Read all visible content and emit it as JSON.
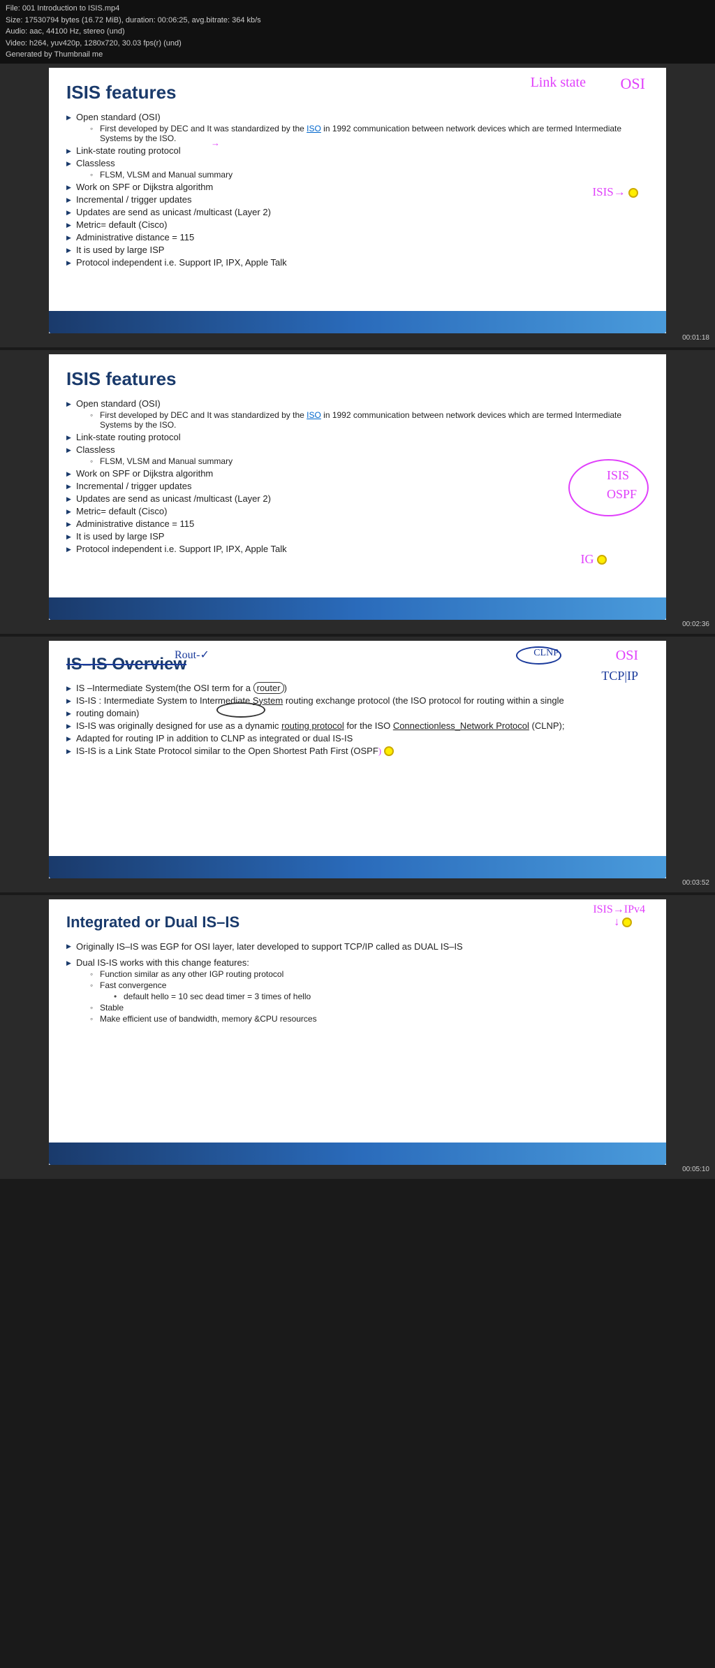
{
  "videoInfo": {
    "filename": "File: 001 Introduction to ISIS.mp4",
    "size": "Size: 17530794 bytes (16.72 MiB), duration: 00:06:25, avg.bitrate: 364 kb/s",
    "audio": "Audio: aac, 44100 Hz, stereo (und)",
    "video": "Video: h264, yuv420p, 1280x720, 30.03 fps(r) (und)",
    "generated": "Generated by Thumbnail me"
  },
  "slides": [
    {
      "id": "slide1",
      "title": "ISIS features",
      "timestamp": "00:01:18",
      "annotations": {
        "ann1": "Link state",
        "ann2": "OSI",
        "ann3": "ISIS→"
      },
      "items": [
        {
          "text": "Open standard (OSI)",
          "sub": [
            "First developed by DEC and It was standardized by the ISO in 1992 communication between network devices which are termed Intermediate Systems by the ISO."
          ]
        },
        {
          "text": "Link-state routing protocol"
        },
        {
          "text": "Classless",
          "sub": [
            "FLSM, VLSM and Manual summary"
          ]
        },
        {
          "text": "Work on SPF or Dijkstra algorithm"
        },
        {
          "text": "Incremental / trigger updates"
        },
        {
          "text": "Updates are send as unicast  /multicast (Layer 2)"
        },
        {
          "text": "Metric= default (Cisco)"
        },
        {
          "text": "Administrative distance  = 115"
        },
        {
          "text": "It is used by large ISP"
        },
        {
          "text": "Protocol independent i.e. Support IP, IPX, Apple Talk"
        }
      ]
    },
    {
      "id": "slide2",
      "title": "ISIS features",
      "timestamp": "00:02:36",
      "annotations": {
        "circle_text1": "ISIS",
        "circle_text2": "OSPF",
        "ann_ig": "IG"
      },
      "items": [
        {
          "text": "Open standard (OSI)",
          "sub": [
            "First developed by DEC and It was standardized by the ISO in 1992 communication between network devices which are termed Intermediate Systems by the ISO."
          ]
        },
        {
          "text": "Link-state routing protocol"
        },
        {
          "text": "Classless",
          "sub": [
            "FLSM, VLSM and Manual summary"
          ]
        },
        {
          "text": "Work on SPF or Dijkstra algorithm"
        },
        {
          "text": "Incremental / trigger updates"
        },
        {
          "text": "Updates are send as unicast  /multicast (Layer 2)"
        },
        {
          "text": "Metric= default (Cisco)"
        },
        {
          "text": "Administrative distance  = 115"
        },
        {
          "text": "It is used by large ISP"
        },
        {
          "text": "Protocol independent i.e. Support IP, IPX, Apple Talk"
        }
      ]
    },
    {
      "id": "slide3",
      "title": "IS–IS Overview",
      "timestamp": "00:03:52",
      "annotations": {
        "ann_rout": "Rout-✓",
        "ann_osi": "OSI",
        "ann_tcp": "TCP|IP",
        "ann_clnp": "CLNP"
      },
      "items": [
        {
          "text": "IS –Intermediate System(the OSI term for a router)"
        },
        {
          "text": "IS-IS : Intermediate System  to Intermediate System routing exchange protocol (the ISO protocol for routing within a single"
        },
        {
          "text": "routing domain)"
        },
        {
          "text": "IS-IS was originally designed for use as a dynamic routing protocol for the ISO Connectionless_Network Protocol (CLNP);"
        },
        {
          "text": "Adapted for routing IP in addition to CLNP  as integrated or dual IS-IS"
        },
        {
          "text": "IS-IS is a Link State Protocol similar to the Open Shortest Path First (OSPF)"
        }
      ]
    },
    {
      "id": "slide4",
      "title": "Integrated or Dual IS–IS",
      "timestamp": "00:05:10",
      "annotations": {
        "ann1": "ISIS→IPv4"
      },
      "items": [
        {
          "text": "Originally IS–IS was EGP for OSI layer, later developed  to support TCP/IP called as DUAL IS–IS"
        },
        {
          "text": "Dual IS-IS works with this change features:",
          "sub": [
            {
              "text": "Function similar as any other IGP routing protocol",
              "bullets": []
            },
            {
              "text": "Fast convergence",
              "bullets": [
                "default  hello = 10 sec   dead timer = 3 times of hello"
              ]
            },
            {
              "text": "Stable",
              "bullets": []
            },
            {
              "text": "Make efficient use of bandwidth, memory &CPU resources",
              "bullets": []
            }
          ]
        }
      ]
    }
  ]
}
